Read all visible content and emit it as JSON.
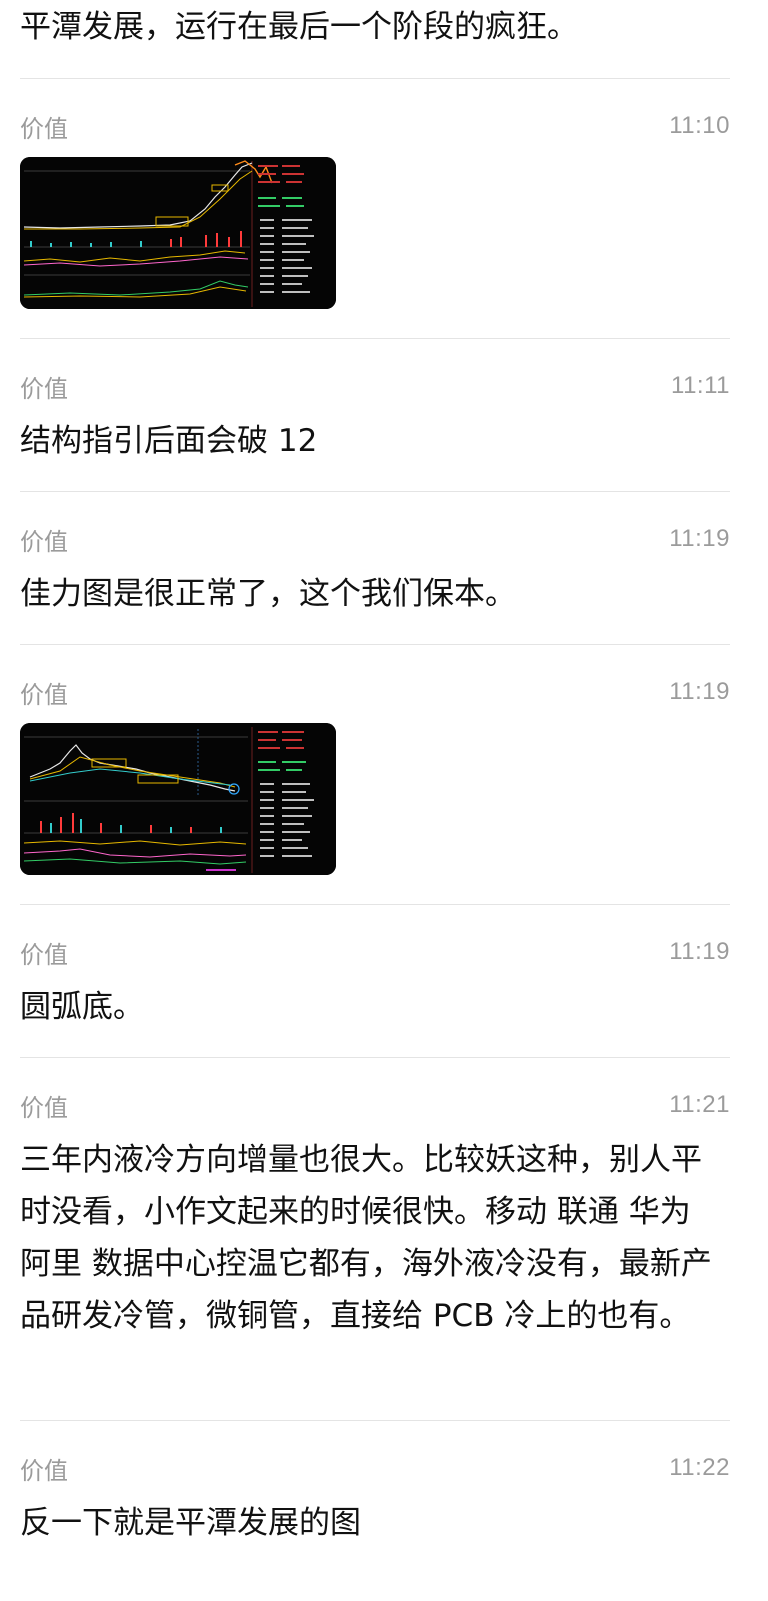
{
  "feed": {
    "top_text": "平潭发展，运行在最后一个阶段的疯狂。",
    "messages": [
      {
        "sender": "价值",
        "time": "11:10",
        "type": "image",
        "image": "stock-chart-thumbnail"
      },
      {
        "sender": "价值",
        "time": "11:11",
        "type": "text",
        "text": "结构指引后面会破 12"
      },
      {
        "sender": "价值",
        "time": "11:19",
        "type": "text",
        "text": "佳力图是很正常了，这个我们保本。"
      },
      {
        "sender": "价值",
        "time": "11:19",
        "type": "image",
        "image": "stock-chart-thumbnail"
      },
      {
        "sender": "价值",
        "time": "11:19",
        "type": "text",
        "text": "圆弧底。"
      },
      {
        "sender": "价值",
        "time": "11:21",
        "type": "text",
        "text": "三年内液冷方向增量也很大。比较妖这种，别人平时没看，小作文起来的时候很快。移动 联通 华为 阿里 数据中心控温它都有，海外液冷没有，最新产品研发冷管，微铜管，直接给 PCB 冷上的也有。"
      },
      {
        "sender": "价值",
        "time": "11:22",
        "type": "text",
        "text": "反一下就是平潭发展的图"
      }
    ]
  },
  "colors": {
    "meta_text": "#9b9b9b",
    "body_text": "#111111",
    "divider": "#e4e4e4",
    "chart_bg": "#050505"
  }
}
